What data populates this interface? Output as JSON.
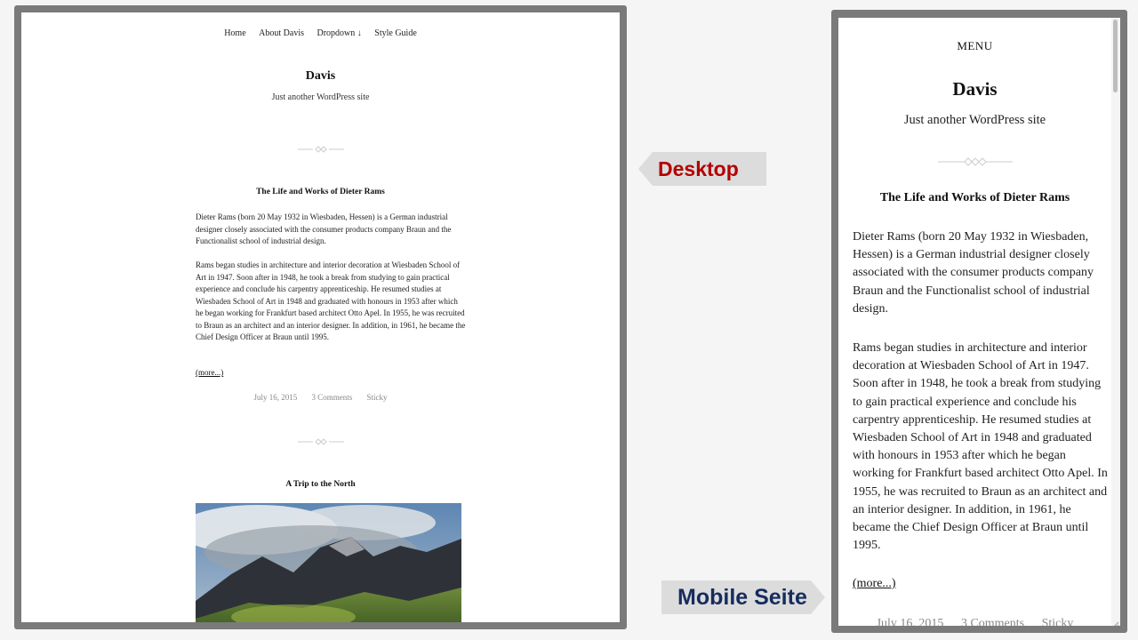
{
  "desktop": {
    "nav": [
      "Home",
      "About Davis",
      "Dropdown ↓",
      "Style Guide"
    ],
    "site_title": "Davis",
    "tagline": "Just another WordPress site",
    "post1": {
      "title": "The Life and Works of Dieter Rams",
      "p1": "Dieter Rams (born 20 May 1932 in Wiesbaden, Hessen) is a German industrial designer closely associated with the consumer products company Braun and the Functionalist school of industrial design.",
      "p2": "Rams began studies in architecture and interior decoration at Wiesbaden School of Art in 1947. Soon after in 1948, he took a break from studying to gain practical experience and conclude his carpentry apprenticeship. He resumed studies at Wiesbaden School of Art in 1948 and graduated with honours in 1953 after which he began working for Frankfurt based architect Otto Apel. In 1955, he was recruited to Braun as an architect and an interior designer. In addition, in 1961, he became the Chief Design Officer at Braun until 1995.",
      "more": "(more...)",
      "date": "July 16, 2015",
      "comments": "3 Comments",
      "sticky": "Sticky"
    },
    "post2": {
      "title": "A Trip to the North"
    }
  },
  "labels": {
    "desktop": "Desktop",
    "mobile": "Mobile Seite"
  },
  "mobile": {
    "menu": "MENU",
    "site_title": "Davis",
    "tagline": "Just another WordPress site",
    "post1": {
      "title": "The Life and Works of Dieter Rams",
      "p1": "Dieter Rams (born 20 May 1932 in Wiesbaden, Hessen) is a German industrial designer closely associated with the consumer products company Braun and the Functionalist school of industrial design.",
      "p2": "Rams began studies in architecture and interior decoration at Wiesbaden School of Art in 1947. Soon after in 1948, he took a break from studying to gain practical experience and conclude his carpentry apprenticeship. He resumed studies at Wiesbaden School of Art in 1948 and graduated with honours in 1953 after which he began working for Frankfurt based architect Otto Apel. In 1955, he was recruited to Braun as an architect and an interior designer. In addition, in 1961, he became the Chief Design Officer at Braun until 1995.",
      "more": "(more...)",
      "date": "July 16, 2015",
      "comments": "3 Comments",
      "sticky": "Sticky"
    }
  },
  "colors": {
    "desktop_label": "#b40000",
    "mobile_label": "#172c5e",
    "frame": "#7a7a7a",
    "meta": "#888888"
  },
  "icons": [
    "ornament-divider-icon",
    "resize-grip-icon"
  ]
}
